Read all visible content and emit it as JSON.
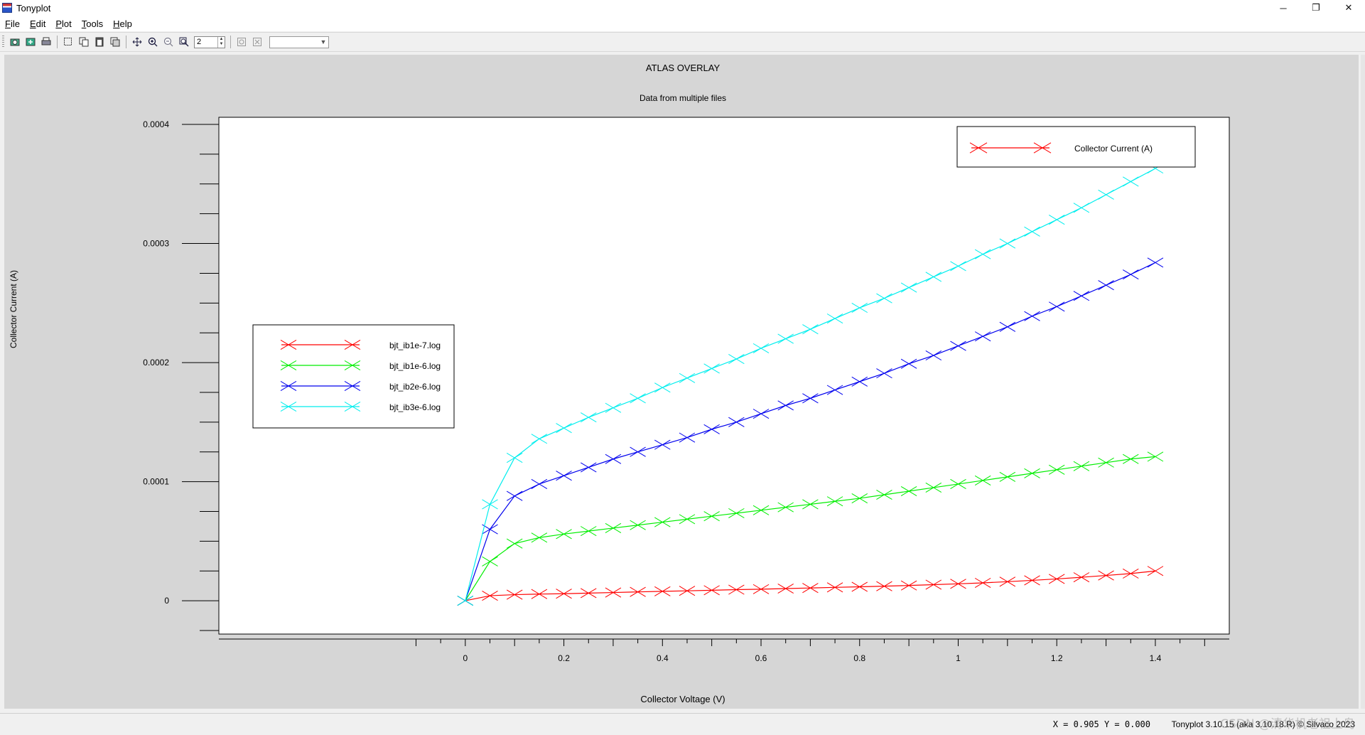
{
  "window": {
    "title": "Tonyplot",
    "minimize": "─",
    "maximize": "❐",
    "close": "✕"
  },
  "menu": [
    "File",
    "Edit",
    "Plot",
    "Tools",
    "Help"
  ],
  "toolbar": {
    "zoom_value": "2"
  },
  "chart_data": {
    "type": "line",
    "title": "ATLAS OVERLAY",
    "subtitle": "Data from multiple files",
    "xlabel": "Collector Voltage (V)",
    "ylabel": "Collector Current (A)",
    "xlim": [
      -0.5,
      1.55
    ],
    "ylim": [
      -2.8e-05,
      0.000406
    ],
    "xticks": [
      0,
      0.2,
      0.4,
      0.6,
      0.8,
      1,
      1.2,
      1.4
    ],
    "xtick_labels": [
      "0",
      "0.2",
      "0.4",
      "0.6",
      "0.8",
      "1",
      "1.2",
      "1.4"
    ],
    "yticks": [
      0,
      0.0001,
      0.0002,
      0.0003,
      0.0004
    ],
    "ytick_labels": [
      "0",
      "0.0001",
      "0.0002",
      "0.0003",
      "0.0004"
    ],
    "x": [
      0,
      0.05,
      0.1,
      0.15,
      0.2,
      0.25,
      0.3,
      0.35,
      0.4,
      0.45,
      0.5,
      0.55,
      0.6,
      0.65,
      0.7,
      0.75,
      0.8,
      0.85,
      0.9,
      0.95,
      1,
      1.05,
      1.1,
      1.15,
      1.2,
      1.25,
      1.3,
      1.35,
      1.4
    ],
    "series": [
      {
        "name": "bjt_ib1e-7.log",
        "color": "#ff0000",
        "values": [
          0,
          4.2e-06,
          5.1e-06,
          5.6e-06,
          5.9e-06,
          6.4e-06,
          6.9e-06,
          7.4e-06,
          7.9e-06,
          8.3e-06,
          8.8e-06,
          9.3e-06,
          9.7e-06,
          1.02e-05,
          1.07e-05,
          1.12e-05,
          1.17e-05,
          1.22e-05,
          1.28e-05,
          1.35e-05,
          1.42e-05,
          1.5e-05,
          1.6e-05,
          1.71e-05,
          1.83e-05,
          1.97e-05,
          2.12e-05,
          2.28e-05,
          2.5e-05
        ]
      },
      {
        "name": "bjt_ib1e-6.log",
        "color": "#00ee00",
        "values": [
          0,
          3.3e-05,
          4.8e-05,
          5.3e-05,
          5.6e-05,
          5.85e-05,
          6.1e-05,
          6.35e-05,
          6.6e-05,
          6.85e-05,
          7.1e-05,
          7.35e-05,
          7.6e-05,
          7.85e-05,
          8.1e-05,
          8.35e-05,
          8.6e-05,
          8.9e-05,
          9.2e-05,
          9.5e-05,
          9.8e-05,
          0.000101,
          0.000104,
          0.000107,
          0.00011,
          0.000113,
          0.000116,
          0.000119,
          0.000121
        ]
      },
      {
        "name": "bjt_ib2e-6.log",
        "color": "#0000ee",
        "values": [
          0,
          6e-05,
          8.8e-05,
          9.8e-05,
          0.000105,
          0.000112,
          0.000119,
          0.000125,
          0.000131,
          0.000137,
          0.000144,
          0.00015,
          0.000157,
          0.000164,
          0.00017,
          0.000177,
          0.000184,
          0.000191,
          0.000199,
          0.000206,
          0.000214,
          0.000222,
          0.00023,
          0.000239,
          0.000247,
          0.000256,
          0.000265,
          0.000274,
          0.000284
        ]
      },
      {
        "name": "bjt_ib3e-6.log",
        "color": "#00eeee",
        "values": [
          0,
          8.1e-05,
          0.00012,
          0.000136,
          0.000145,
          0.000154,
          0.000162,
          0.00017,
          0.000179,
          0.000187,
          0.000195,
          0.000203,
          0.000212,
          0.00022,
          0.000228,
          0.000237,
          0.000246,
          0.000254,
          0.000263,
          0.000272,
          0.000281,
          0.000291,
          0.0003,
          0.00031,
          0.00032,
          0.00033,
          0.000341,
          0.000352,
          0.000363
        ]
      }
    ],
    "legend_files": {
      "entries": [
        "bjt_ib1e-7.log",
        "bjt_ib1e-6.log",
        "bjt_ib2e-6.log",
        "bjt_ib3e-6.log"
      ],
      "colors": [
        "#ff0000",
        "#00ee00",
        "#0000ee",
        "#00eeee"
      ],
      "placement": "left-middle"
    },
    "legend_quantity": {
      "entries": [
        "Collector Current (A)"
      ],
      "colors": [
        "#ff0000"
      ],
      "placement": "top-right"
    },
    "marker": "x",
    "grid": false
  },
  "status": {
    "coord": "X = 0.905 Y = 0.000",
    "version": "Tonyplot 3.10.15 (aka 3.10.18.R) © Silvaco 2023",
    "watermark": "CSDN @清华机老祖上岛"
  }
}
